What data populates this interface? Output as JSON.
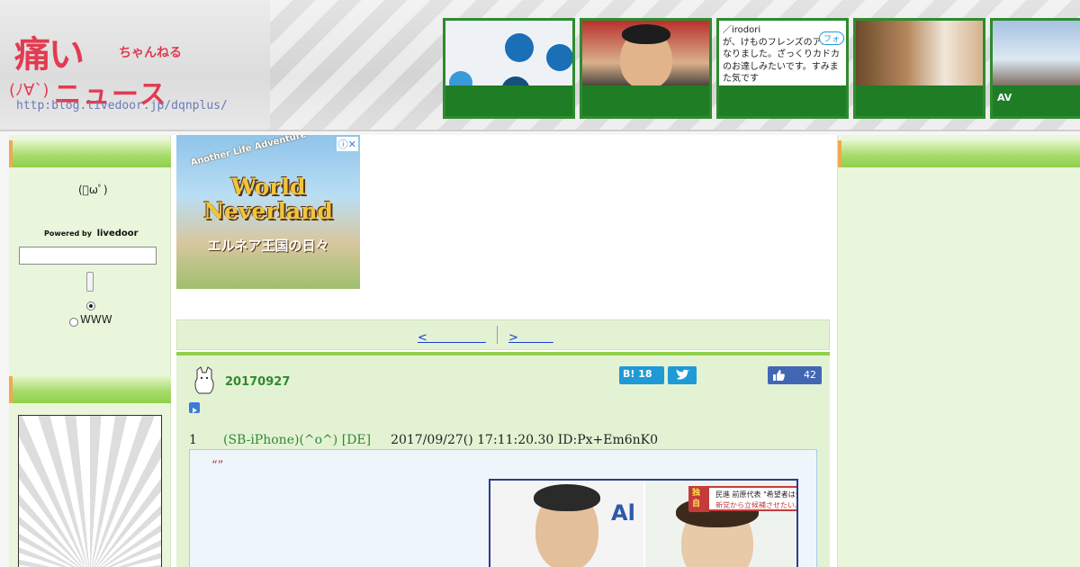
{
  "header": {
    "logo": {
      "kanji": "痛い",
      "chan": "ちゃんねる",
      "news": "ニュース",
      "face": "(ﾉ∀`)",
      "url": "http:blog.livedoor.jp/dqnplus/"
    },
    "thumbs": [
      {
        "text": "",
        "bar": ""
      },
      {
        "text": "",
        "bar": ""
      },
      {
        "text": "／irodori\nが、けものフレンズのアニメ\nなりました。ざっくりカドカ\nのお達しみたいです。すみま\nた気です",
        "badge": "フォ",
        "bar": ""
      },
      {
        "text": "",
        "bar": ""
      },
      {
        "text": "",
        "bar": "AV"
      }
    ]
  },
  "left": {
    "face_icon": "(ﾟωﾟ)",
    "powered_by": "Powered by",
    "brand": "livedoor",
    "search_value": "",
    "radio_www": "WWW"
  },
  "banner": {
    "ring": "Another Life Adventure",
    "title": "World Neverland",
    "subtitle": "エルネア王国の日々",
    "close": "ⓘ✕"
  },
  "pager": {
    "prev": "<　　　　　",
    "next": ">　　　"
  },
  "entry": {
    "date": "20170927",
    "hatena_label": "B!",
    "hatena_count": "18",
    "fb_count": "42",
    "res_number": "1",
    "res_name": "(SB-iPhone)(^o^) [DE]",
    "res_datetime": "2017/09/27() 17:11:20.30 ID:Px+Em6nK0",
    "quote": "“”",
    "image": {
      "left_text": "Al",
      "tag": "独自",
      "caption_line1": "民進 前原代表 \"希望者は全員",
      "caption_line2": "新党から立候補させたい。"
    }
  }
}
